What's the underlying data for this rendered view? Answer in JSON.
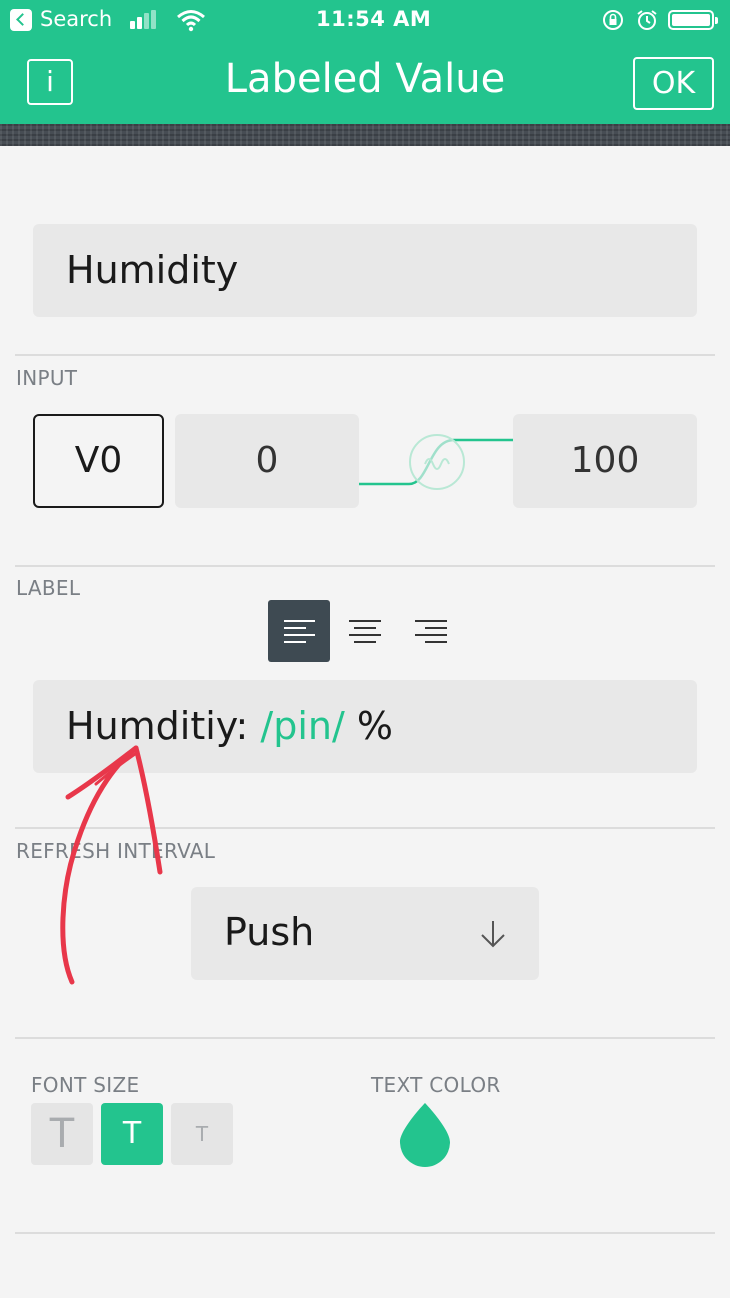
{
  "status_bar": {
    "back_label": "Search",
    "time": "11:54 AM"
  },
  "header": {
    "info_label": "i",
    "title": "Labeled Value",
    "ok_label": "OK"
  },
  "name_field": {
    "value": "Humidity"
  },
  "input_section": {
    "label": "INPUT",
    "pin": "V0",
    "min": "0",
    "max": "100"
  },
  "label_section": {
    "label": "LABEL",
    "alignment_selected": "left",
    "text_prefix": "Humditiy: ",
    "text_pin": "/pin/",
    "text_suffix": " %"
  },
  "refresh_section": {
    "label": "REFRESH INTERVAL",
    "value": "Push"
  },
  "font_size_section": {
    "label": "FONT SIZE",
    "options": [
      "T",
      "T",
      "T"
    ],
    "selected_index": 1
  },
  "text_color_section": {
    "label": "TEXT COLOR",
    "color": "#23c48e"
  },
  "colors": {
    "accent": "#23c48e",
    "annotation": "#e8374a"
  }
}
